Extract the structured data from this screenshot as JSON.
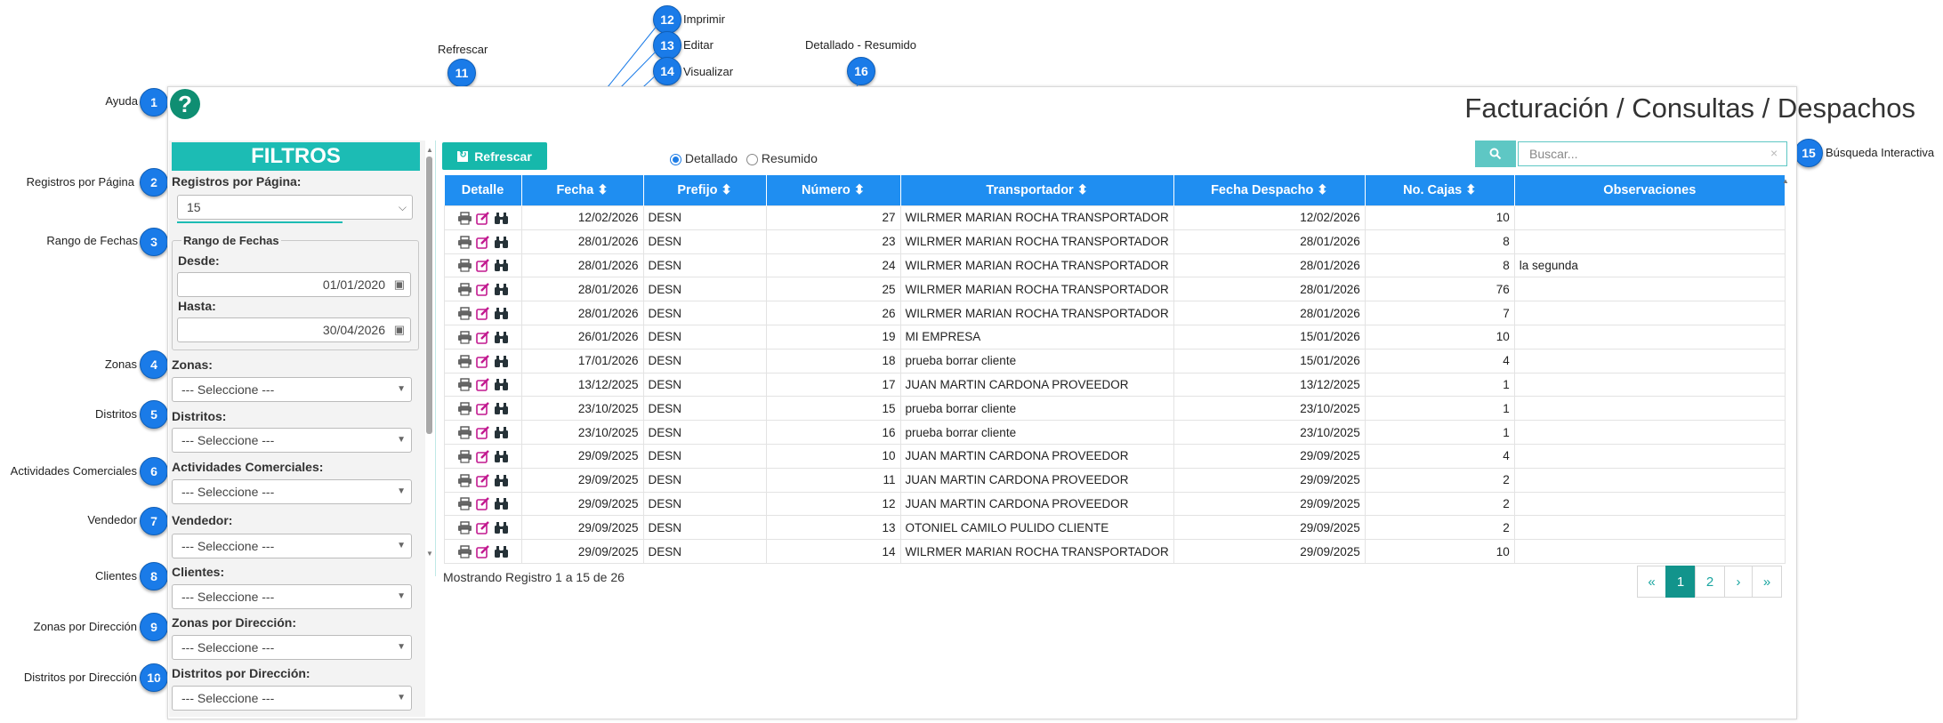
{
  "header": {
    "title": "Facturación / Consultas / Despachos",
    "help_symbol": "?"
  },
  "annotations": {
    "n1": {
      "num": "1",
      "label": "Ayuda"
    },
    "n2": {
      "num": "2",
      "label": "Registros por Página"
    },
    "n3": {
      "num": "3",
      "label": "Rango de Fechas"
    },
    "n4": {
      "num": "4",
      "label": "Zonas"
    },
    "n5": {
      "num": "5",
      "label": "Distritos"
    },
    "n6": {
      "num": "6",
      "label": "Actividades Comerciales"
    },
    "n7": {
      "num": "7",
      "label": "Vendedor"
    },
    "n8": {
      "num": "8",
      "label": "Clientes"
    },
    "n9": {
      "num": "9",
      "label": "Zonas por Dirección"
    },
    "n10": {
      "num": "10",
      "label": "Distritos por Dirección"
    },
    "n11": {
      "num": "11",
      "label": "Refrescar"
    },
    "n12": {
      "num": "12",
      "label": "Imprimir"
    },
    "n13": {
      "num": "13",
      "label": "Editar"
    },
    "n14": {
      "num": "14",
      "label": "Visualizar"
    },
    "n15": {
      "num": "15",
      "label": "Búsqueda Interactiva"
    },
    "n16": {
      "num": "16",
      "label": "Detallado - Resumido"
    }
  },
  "filters": {
    "heading": "FILTROS",
    "registros_label": "Registros por Página:",
    "registros_value": "15",
    "rango_label": "Rango de Fechas",
    "desde_label": "Desde:",
    "desde_value": "01/01/2020",
    "hasta_label": "Hasta:",
    "hasta_value": "30/04/2026",
    "zonas_label": "Zonas:",
    "distritos_label": "Distritos:",
    "actividades_label": "Actividades Comerciales:",
    "vendedor_label": "Vendedor:",
    "clientes_label": "Clientes:",
    "zonas_dir_label": "Zonas por Dirección:",
    "distritos_dir_label": "Distritos por Dirección:",
    "select_placeholder": "--- Seleccione ---"
  },
  "toolbar": {
    "refresh_label": "Refrescar",
    "detallado_label": "Detallado",
    "resumido_label": "Resumido",
    "search_placeholder": "Buscar...",
    "accent_color": "#16b8ab"
  },
  "table": {
    "columns": [
      "Detalle",
      "Fecha",
      "Prefijo",
      "Número",
      "Transportador",
      "Fecha Despacho",
      "No. Cajas",
      "Observaciones"
    ],
    "rows": [
      {
        "fecha": "12/02/2026",
        "prefijo": "DESN",
        "numero": "27",
        "transportador": "WILRMER MARIAN ROCHA TRANSPORTADOR",
        "fecha_despacho": "12/02/2026",
        "cajas": "10",
        "obs": ""
      },
      {
        "fecha": "28/01/2026",
        "prefijo": "DESN",
        "numero": "23",
        "transportador": "WILRMER MARIAN ROCHA TRANSPORTADOR",
        "fecha_despacho": "28/01/2026",
        "cajas": "8",
        "obs": ""
      },
      {
        "fecha": "28/01/2026",
        "prefijo": "DESN",
        "numero": "24",
        "transportador": "WILRMER MARIAN ROCHA TRANSPORTADOR",
        "fecha_despacho": "28/01/2026",
        "cajas": "8",
        "obs": "la segunda"
      },
      {
        "fecha": "28/01/2026",
        "prefijo": "DESN",
        "numero": "25",
        "transportador": "WILRMER MARIAN ROCHA TRANSPORTADOR",
        "fecha_despacho": "28/01/2026",
        "cajas": "76",
        "obs": ""
      },
      {
        "fecha": "28/01/2026",
        "prefijo": "DESN",
        "numero": "26",
        "transportador": "WILRMER MARIAN ROCHA TRANSPORTADOR",
        "fecha_despacho": "28/01/2026",
        "cajas": "7",
        "obs": ""
      },
      {
        "fecha": "26/01/2026",
        "prefijo": "DESN",
        "numero": "19",
        "transportador": "MI EMPRESA",
        "fecha_despacho": "15/01/2026",
        "cajas": "10",
        "obs": ""
      },
      {
        "fecha": "17/01/2026",
        "prefijo": "DESN",
        "numero": "18",
        "transportador": "prueba borrar cliente",
        "fecha_despacho": "15/01/2026",
        "cajas": "4",
        "obs": ""
      },
      {
        "fecha": "13/12/2025",
        "prefijo": "DESN",
        "numero": "17",
        "transportador": "JUAN MARTIN CARDONA PROVEEDOR",
        "fecha_despacho": "13/12/2025",
        "cajas": "1",
        "obs": ""
      },
      {
        "fecha": "23/10/2025",
        "prefijo": "DESN",
        "numero": "15",
        "transportador": "prueba borrar cliente",
        "fecha_despacho": "23/10/2025",
        "cajas": "1",
        "obs": ""
      },
      {
        "fecha": "23/10/2025",
        "prefijo": "DESN",
        "numero": "16",
        "transportador": "prueba borrar cliente",
        "fecha_despacho": "23/10/2025",
        "cajas": "1",
        "obs": ""
      },
      {
        "fecha": "29/09/2025",
        "prefijo": "DESN",
        "numero": "10",
        "transportador": "JUAN MARTIN CARDONA PROVEEDOR",
        "fecha_despacho": "29/09/2025",
        "cajas": "4",
        "obs": ""
      },
      {
        "fecha": "29/09/2025",
        "prefijo": "DESN",
        "numero": "11",
        "transportador": "JUAN MARTIN CARDONA PROVEEDOR",
        "fecha_despacho": "29/09/2025",
        "cajas": "2",
        "obs": ""
      },
      {
        "fecha": "29/09/2025",
        "prefijo": "DESN",
        "numero": "12",
        "transportador": "JUAN MARTIN CARDONA PROVEEDOR",
        "fecha_despacho": "29/09/2025",
        "cajas": "2",
        "obs": ""
      },
      {
        "fecha": "29/09/2025",
        "prefijo": "DESN",
        "numero": "13",
        "transportador": "OTONIEL CAMILO PULIDO CLIENTE",
        "fecha_despacho": "29/09/2025",
        "cajas": "2",
        "obs": ""
      },
      {
        "fecha": "29/09/2025",
        "prefijo": "DESN",
        "numero": "14",
        "transportador": "WILRMER MARIAN ROCHA TRANSPORTADOR",
        "fecha_despacho": "29/09/2025",
        "cajas": "10",
        "obs": ""
      }
    ]
  },
  "footer": {
    "showing": "Mostrando Registro 1 a 15 de 26"
  },
  "pagination": {
    "first": "«",
    "p1": "1",
    "p2": "2",
    "next": "›",
    "last": "»"
  }
}
